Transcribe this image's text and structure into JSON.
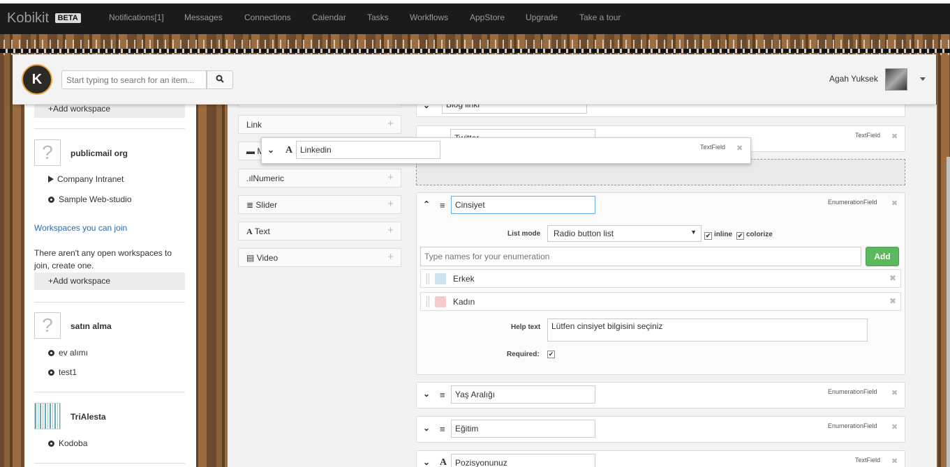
{
  "navbar": {
    "brand": "Kobikit",
    "badge": "BETA",
    "items": [
      "Notifications[1]",
      "Messages",
      "Connections",
      "Calendar",
      "Tasks",
      "Workflows",
      "AppStore",
      "Upgrade",
      "Take a tour"
    ]
  },
  "header": {
    "logo_text": "K",
    "search_placeholder": "Start typing to search for an item...",
    "user_name": "Agah Yuksek"
  },
  "sidebar": {
    "add_workspace_1": "+Add workspace",
    "ws1": {
      "title": "publicmail org",
      "items": [
        "Company Intranet",
        "Sample Web-studio"
      ]
    },
    "join_link": "Workspaces you can join",
    "no_open_text": "There aren't any open workspaces to join, create one.",
    "add_workspace_2": "+Add workspace",
    "ws2": {
      "title": "satın alma",
      "items": [
        "ev alımı",
        "test1"
      ]
    },
    "ws3": {
      "title": "TriAlesta",
      "items": [
        "Kodoba"
      ]
    }
  },
  "field_types": [
    {
      "icon": "",
      "label": "Link"
    },
    {
      "icon": "▬",
      "label": "M"
    },
    {
      "icon": ".ıl",
      "label": "Numeric"
    },
    {
      "icon": "≣",
      "label": "Slider"
    },
    {
      "icon": "A",
      "label": "Text"
    },
    {
      "icon": "▤",
      "label": "Video"
    }
  ],
  "fields": {
    "blog": {
      "name": "Blog linki"
    },
    "twitter": {
      "name": "Twitter",
      "type": "TextField"
    },
    "dragging": {
      "name": "Linkedin",
      "type": "TextField"
    },
    "cinsiyet": {
      "name": "Cinsiyet",
      "type": "EnumerationField",
      "list_mode_label": "List mode",
      "list_mode_value": "Radio button list",
      "inline_label": "inline",
      "colorize_label": "colorize",
      "enum_placeholder": "Type names for your enumeration",
      "add_label": "Add",
      "options": [
        {
          "label": "Erkek",
          "color": "#cfe2ef"
        },
        {
          "label": "Kadın",
          "color": "#f4cccc"
        }
      ],
      "help_label": "Help text",
      "help_value": "Lütfen cinsiyet bilgisini seçiniz",
      "required_label": "Required:"
    },
    "yas": {
      "name": "Yaş Aralığı",
      "type": "EnumerationField"
    },
    "egitim": {
      "name": "Eğitim",
      "type": "EnumerationField"
    },
    "pozisyon": {
      "name": "Pozisyonunuz",
      "type": "TextField"
    }
  }
}
